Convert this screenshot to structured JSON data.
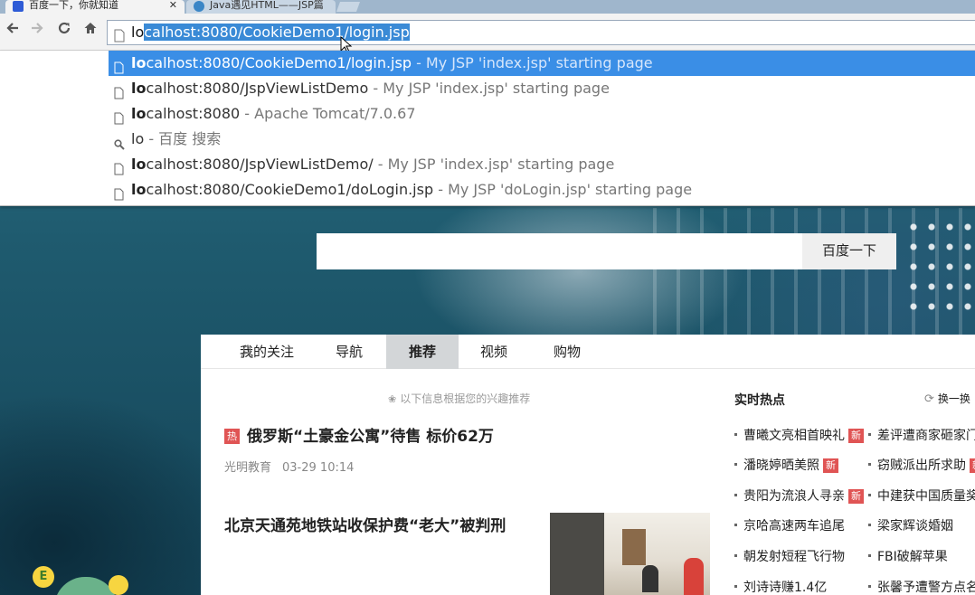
{
  "browser": {
    "tabs": [
      {
        "title": "百度一下，你就知道",
        "active": true
      },
      {
        "title": "Java遇见HTML——JSP篇",
        "active": false
      }
    ],
    "omnibox": {
      "typed": "lo",
      "autocomplete_selected": "calhost:8080/CookieDemo1/login.jsp"
    },
    "suggestions": [
      {
        "match": "lo",
        "rest": "calhost:8080/CookieDemo1/login.jsp",
        "desc": " - My JSP 'index.jsp' starting page",
        "icon": "page-icon",
        "active": true
      },
      {
        "match": "lo",
        "rest": "calhost:8080/JspViewListDemo",
        "desc": " - My JSP 'index.jsp' starting page",
        "icon": "page-icon",
        "active": false
      },
      {
        "match": "lo",
        "rest": "calhost:8080",
        "desc": " - Apache Tomcat/7.0.67",
        "icon": "page-icon",
        "active": false
      },
      {
        "match": "",
        "rest": "lo",
        "desc": " - 百度 搜索",
        "icon": "search-icon",
        "active": false
      },
      {
        "match": "lo",
        "rest": "calhost:8080/JspViewListDemo/",
        "desc": " - My JSP 'index.jsp' starting page",
        "icon": "page-icon",
        "active": false
      },
      {
        "match": "lo",
        "rest": "calhost:8080/CookieDemo1/doLogin.jsp",
        "desc": " - My JSP 'doLogin.jsp' starting page",
        "icon": "page-icon",
        "active": false
      }
    ]
  },
  "baidu": {
    "search_button": "百度一下",
    "nav_tabs": [
      "我的关注",
      "导航",
      "推荐",
      "视频",
      "购物"
    ],
    "active_tab": "推荐",
    "rec_hint": "以下信息根据您的兴趣推荐",
    "news": [
      {
        "tag": "热",
        "title": "俄罗斯“土豪金公寓”待售 标价62万",
        "source": "光明教育",
        "time": "03-29 10:14"
      },
      {
        "title": "北京天通苑地铁站收保护费“老大”被判刑"
      }
    ],
    "hot": {
      "title": "实时热点",
      "refresh": "换一换",
      "items": [
        {
          "text": "曹曦文亮相首映礼",
          "tag": "新"
        },
        {
          "text": "差评遭商家砸家门",
          "tag": ""
        },
        {
          "text": "潘晓婷晒美照",
          "tag": "新"
        },
        {
          "text": "窃贼派出所求助",
          "tag": "新"
        },
        {
          "text": "贵阳为流浪人寻亲",
          "tag": "新"
        },
        {
          "text": "中建获中国质量奖",
          "tag": ""
        },
        {
          "text": "京哈高速两车追尾",
          "tag": ""
        },
        {
          "text": "梁家辉谈婚姻",
          "tag": ""
        },
        {
          "text": "朝发射短程飞行物",
          "tag": ""
        },
        {
          "text": "FBI破解苹果",
          "tag": ""
        },
        {
          "text": "刘诗诗赚1.4亿",
          "tag": ""
        },
        {
          "text": "张馨予遭警方点名",
          "tag": ""
        }
      ]
    },
    "mascot_letter": "E"
  },
  "colors": {
    "selection_blue": "#3a8ee6",
    "hot_red": "#e05454",
    "active_tab_bg": "#d3d6d8"
  }
}
